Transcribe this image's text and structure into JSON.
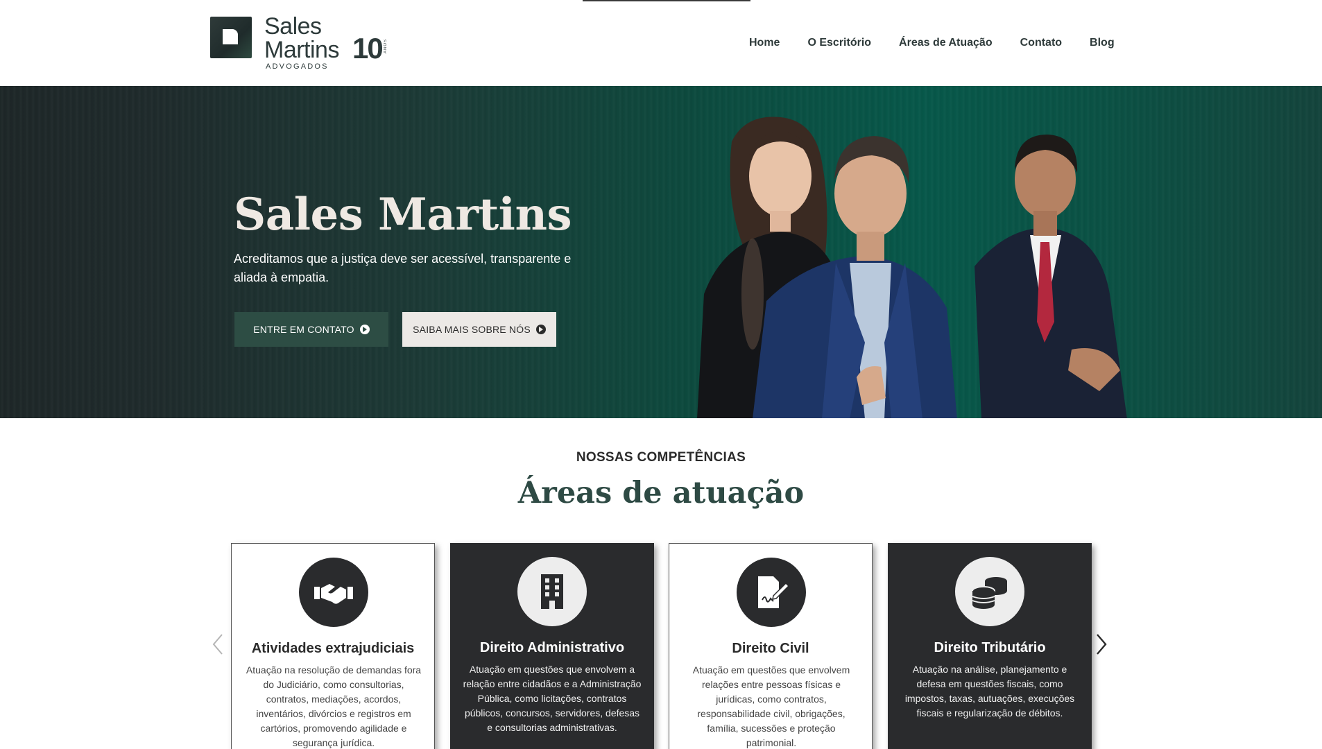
{
  "logo": {
    "line1": "Sales",
    "line2": "Martins",
    "years": "10",
    "years_label": "ANOS",
    "tagline": "ADVOGADOS"
  },
  "nav": {
    "items": [
      {
        "label": "Home"
      },
      {
        "label": "O Escritório"
      },
      {
        "label": "Áreas de Atuação"
      },
      {
        "label": "Contato"
      },
      {
        "label": "Blog"
      }
    ]
  },
  "hero": {
    "title": "Sales Martins",
    "subtitle": "Acreditamos que a justiça deve ser acessível, transparente e aliada à empatia.",
    "btn_contact": "ENTRE EM CONTATO",
    "btn_about": "SAIBA MAIS SOBRE NÓS"
  },
  "section": {
    "kicker": "NOSSAS COMPETÊNCIAS",
    "title": "Áreas de atuação"
  },
  "cards": [
    {
      "icon": "handshake-icon",
      "title": "Atividades extrajudiciais",
      "text": "Atuação na resolução de demandas fora do Judiciário, como consultorias, contratos, mediações, acordos, inventários, divórcios e registros em cartórios, promovendo agilidade e segurança jurídica."
    },
    {
      "icon": "building-icon",
      "title": "Direito Administrativo",
      "text": "Atuação em questões que envolvem a relação entre cidadãos e a Administração Pública, como licitações, contratos públicos, concursos, servidores, defesas e consultorias administrativas."
    },
    {
      "icon": "file-signature-icon",
      "title": "Direito Civil",
      "text": "Atuação em questões que envolvem relações entre pessoas físicas e jurídicas, como contratos, responsabilidade civil, obrigações, família, sucessões e proteção patrimonial."
    },
    {
      "icon": "coins-icon",
      "title": "Direito Tributário",
      "text": "Atuação na análise, planejamento e defesa em questões fiscais, como impostos, taxas, autuações, execuções fiscais e regularização de débitos."
    }
  ],
  "colors": {
    "accent_green": "#2e4a44",
    "button_green": "#2d4d44",
    "card_dark": "#2a2b2d",
    "hero_teal": "#07584a"
  }
}
